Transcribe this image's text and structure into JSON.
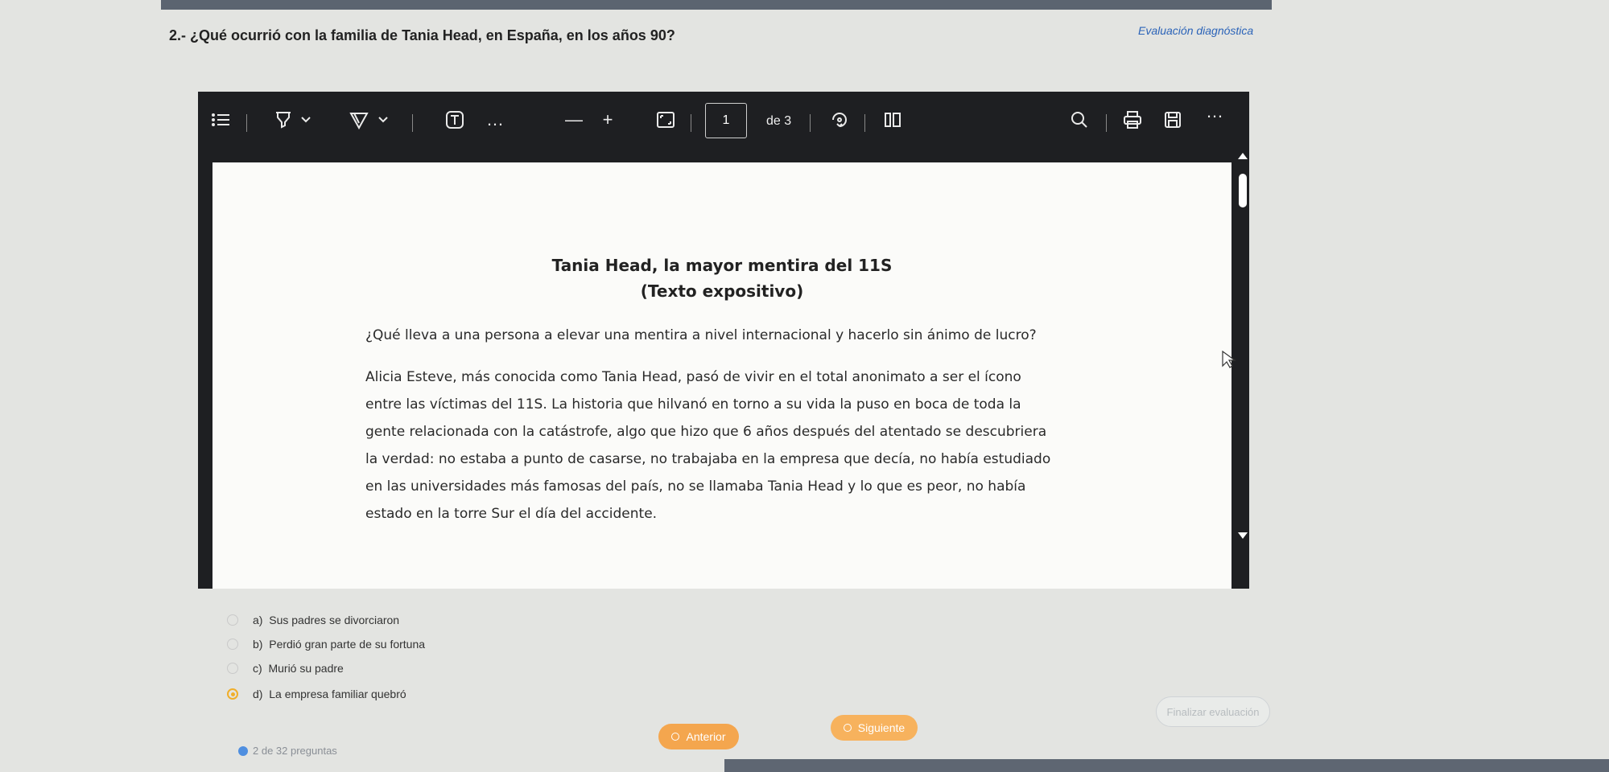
{
  "question": {
    "title": "2.- ¿Qué ocurrió con la familia de Tania Head, en España, en los años 90?",
    "tag": "Evaluación diagnóstica"
  },
  "viewer": {
    "page_current": "1",
    "page_total_label": "de 3",
    "tools": {
      "list": "list-icon",
      "highlight": "highlighter-icon",
      "draw": "draw-icon",
      "text": "text-box-icon",
      "more": "…",
      "zoom_out": "—",
      "zoom_in": "+",
      "fit": "fit-page-icon",
      "rotate": "rotate-icon",
      "read_aloud": "read-aloud-icon",
      "search": "search-icon",
      "print": "print-icon",
      "save": "save-icon",
      "overflow": "…"
    }
  },
  "document": {
    "title": "Tania Head, la mayor mentira del 11S",
    "subtitle": "(Texto expositivo)",
    "intro": "¿Qué lleva a una persona a elevar una mentira a nivel internacional y hacerlo sin ánimo de lucro?",
    "lines": [
      "Alicia Esteve, más conocida como Tania Head, pasó de vivir en el total anonimato a ser el ícono",
      "entre las víctimas del 11S. La historia que hilvanó en torno a su vida la puso en boca de toda la",
      "gente relacionada con la catástrofe, algo que hizo que 6 años después del atentado se descubriera",
      "la verdad: no estaba a punto de casarse, no trabajaba en la empresa que decía, no había estudiado",
      "en las universidades más famosas del país, no se llamaba Tania Head y lo que es peor, no había",
      "estado en la torre Sur el día del accidente."
    ]
  },
  "options": [
    {
      "letter": "a)",
      "text": "Sus padres se divorciaron",
      "selected": false
    },
    {
      "letter": "b)",
      "text": "Perdió gran parte de su fortuna",
      "selected": false
    },
    {
      "letter": "c)",
      "text": "Murió su padre",
      "selected": false
    },
    {
      "letter": "d)",
      "text": "La empresa familiar quebró",
      "selected": true
    }
  ],
  "footer": {
    "counter": "2 de 32 preguntas",
    "prev": "Anterior",
    "next": "Siguiente",
    "finish": "Finalizar evaluación"
  },
  "colors": {
    "accent": "#f0ae2a",
    "viewer_bg": "#1e1f22",
    "link": "#2b63b8"
  }
}
